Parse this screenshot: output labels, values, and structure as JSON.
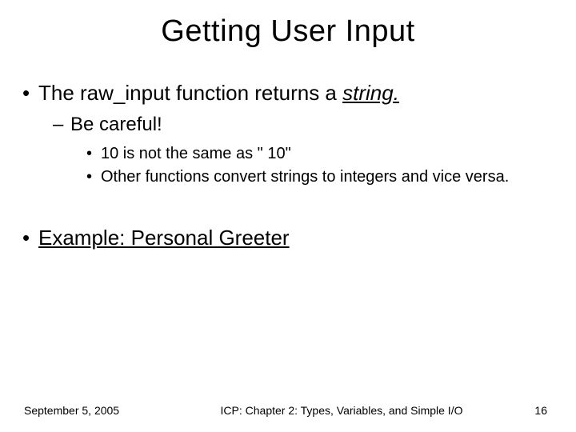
{
  "title": "Getting User Input",
  "bullets": {
    "b1a_prefix": "The raw_input function returns a ",
    "b1a_emph": "string.",
    "b2a": "Be careful!",
    "b3a": "10 is not the same as \" 10\"",
    "b3b": "Other functions convert strings to integers and vice versa.",
    "b1b": "Example: Personal Greeter"
  },
  "footer": {
    "date": "September 5,  2005",
    "center": "ICP: Chapter 2: Types, Variables, and Simple I/O",
    "page": "16"
  }
}
